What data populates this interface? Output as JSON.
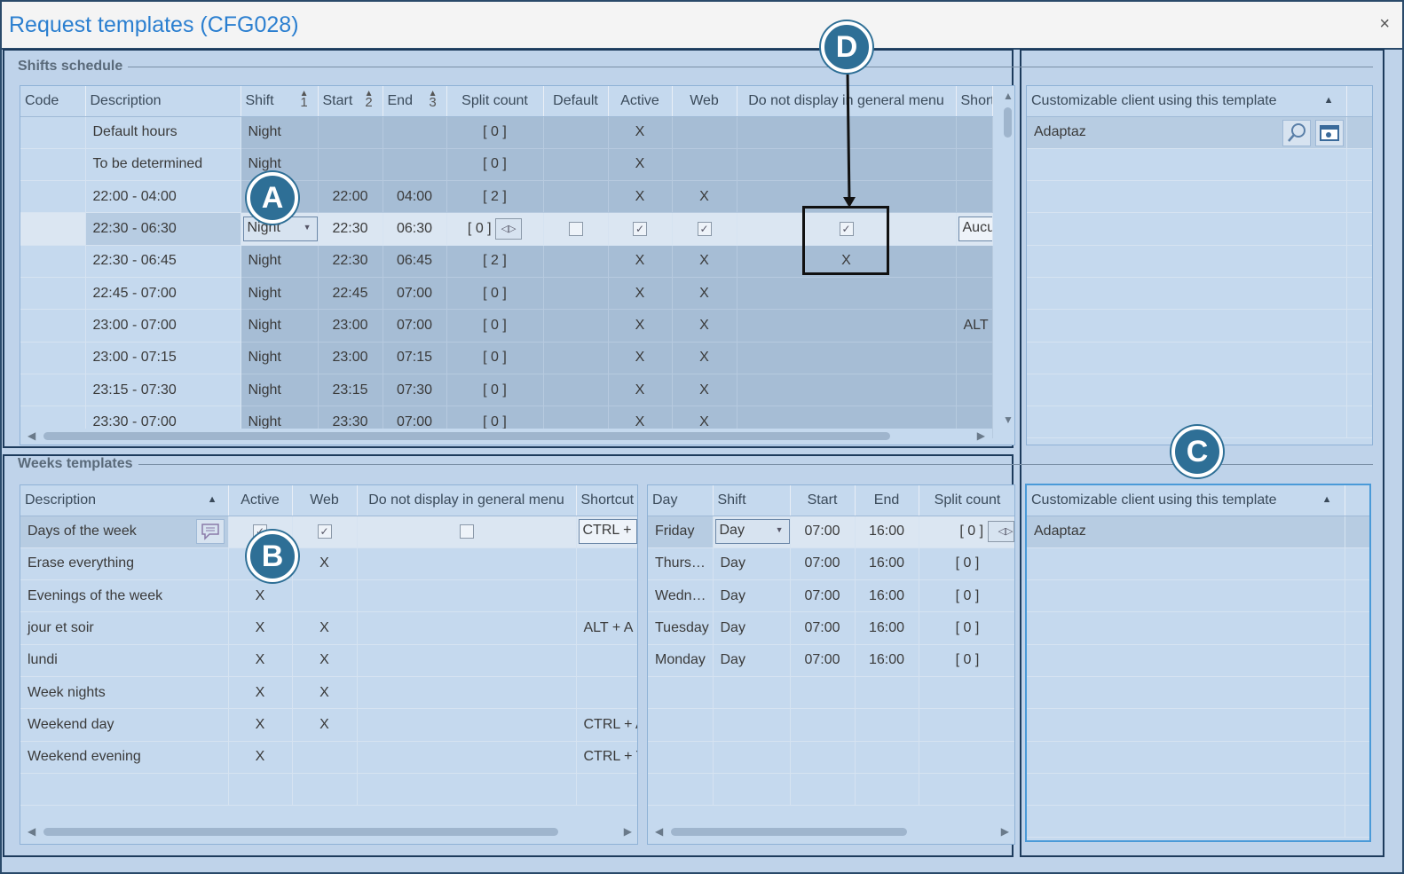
{
  "window": {
    "title": "Request templates (CFG028)",
    "close_glyph": "×"
  },
  "shifts": {
    "group_title": "Shifts schedule",
    "columns": [
      "Code",
      "Description",
      "Shift",
      "Start",
      "End",
      "Split count",
      "Default",
      "Active",
      "Web",
      "Do not display in general menu",
      "Short"
    ],
    "sort_orders": {
      "shift": "1",
      "start": "2",
      "end": "3"
    },
    "rows": [
      {
        "code": "",
        "description": "Default hours",
        "shift": "Night",
        "start": "",
        "end": "",
        "split": "[ 0 ]",
        "default": "",
        "active": "X",
        "web": "",
        "nodisplay": "",
        "short": ""
      },
      {
        "code": "",
        "description": "To be determined",
        "shift": "Night",
        "start": "",
        "end": "",
        "split": "[ 0 ]",
        "default": "",
        "active": "X",
        "web": "",
        "nodisplay": "",
        "short": ""
      },
      {
        "code": "",
        "description": "22:00 - 04:00",
        "shift": "Night",
        "start": "22:00",
        "end": "04:00",
        "split": "[ 2 ]",
        "default": "",
        "active": "X",
        "web": "X",
        "nodisplay": "",
        "short": ""
      },
      {
        "code": "",
        "description": "22:30 - 06:30",
        "shift": "Night",
        "start": "22:30",
        "end": "06:30",
        "split": "[ 0 ]",
        "default": "",
        "active": "✓",
        "web": "✓",
        "nodisplay": "✓",
        "short": "Aucun"
      },
      {
        "code": "",
        "description": "22:30 - 06:45",
        "shift": "Night",
        "start": "22:30",
        "end": "06:45",
        "split": "[ 2 ]",
        "default": "",
        "active": "X",
        "web": "X",
        "nodisplay": "X",
        "short": ""
      },
      {
        "code": "",
        "description": "22:45 - 07:00",
        "shift": "Night",
        "start": "22:45",
        "end": "07:00",
        "split": "[ 0 ]",
        "default": "",
        "active": "X",
        "web": "X",
        "nodisplay": "",
        "short": ""
      },
      {
        "code": "",
        "description": "23:00 - 07:00",
        "shift": "Night",
        "start": "23:00",
        "end": "07:00",
        "split": "[ 0 ]",
        "default": "",
        "active": "X",
        "web": "X",
        "nodisplay": "",
        "short": "ALT -"
      },
      {
        "code": "",
        "description": "23:00 - 07:15",
        "shift": "Night",
        "start": "23:00",
        "end": "07:15",
        "split": "[ 0 ]",
        "default": "",
        "active": "X",
        "web": "X",
        "nodisplay": "",
        "short": ""
      },
      {
        "code": "",
        "description": "23:15 - 07:30",
        "shift": "Night",
        "start": "23:15",
        "end": "07:30",
        "split": "[ 0 ]",
        "default": "",
        "active": "X",
        "web": "X",
        "nodisplay": "",
        "short": ""
      },
      {
        "code": "",
        "description": "23:30 - 07:00",
        "shift": "Night",
        "start": "23:30",
        "end": "07:00",
        "split": "[ 0 ]",
        "default": "",
        "active": "X",
        "web": "X",
        "nodisplay": "",
        "short": ""
      }
    ]
  },
  "client_top": {
    "header": "Customizable client using this template",
    "rows": [
      "Adaptaz"
    ]
  },
  "weeks": {
    "group_title": "Weeks templates",
    "columns": [
      "Description",
      "Active",
      "Web",
      "Do not display in general menu",
      "Shortcut"
    ],
    "rows": [
      {
        "description": "Days of the week",
        "active": "✓",
        "web": "✓",
        "nodisplay": "",
        "shortcut": "CTRL + R"
      },
      {
        "description": "Erase everything",
        "active": "X",
        "web": "X",
        "nodisplay": "",
        "shortcut": ""
      },
      {
        "description": "Evenings of the week",
        "active": "X",
        "web": "",
        "nodisplay": "",
        "shortcut": ""
      },
      {
        "description": "jour et soir",
        "active": "X",
        "web": "X",
        "nodisplay": "",
        "shortcut": "ALT + A"
      },
      {
        "description": "lundi",
        "active": "X",
        "web": "X",
        "nodisplay": "",
        "shortcut": ""
      },
      {
        "description": "Week nights",
        "active": "X",
        "web": "X",
        "nodisplay": "",
        "shortcut": ""
      },
      {
        "description": "Weekend day",
        "active": "X",
        "web": "X",
        "nodisplay": "",
        "shortcut": "CTRL + A"
      },
      {
        "description": "Weekend evening",
        "active": "X",
        "web": "",
        "nodisplay": "",
        "shortcut": "CTRL + T"
      }
    ]
  },
  "days": {
    "columns": [
      "Day",
      "Shift",
      "Start",
      "End",
      "Split count"
    ],
    "rows": [
      {
        "day": "Friday",
        "shift": "Day",
        "start": "07:00",
        "end": "16:00",
        "split": "[ 0 ]"
      },
      {
        "day": "Thurs…",
        "shift": "Day",
        "start": "07:00",
        "end": "16:00",
        "split": "[ 0 ]"
      },
      {
        "day": "Wedn…",
        "shift": "Day",
        "start": "07:00",
        "end": "16:00",
        "split": "[ 0 ]"
      },
      {
        "day": "Tuesday",
        "shift": "Day",
        "start": "07:00",
        "end": "16:00",
        "split": "[ 0 ]"
      },
      {
        "day": "Monday",
        "shift": "Day",
        "start": "07:00",
        "end": "16:00",
        "split": "[ 0 ]"
      }
    ]
  },
  "client_bottom": {
    "header": "Customizable client using this template",
    "rows": [
      "Adaptaz"
    ]
  },
  "callouts": {
    "a": "A",
    "b": "B",
    "c": "C",
    "d": "D"
  },
  "icons": {
    "search": "search-icon",
    "client": "client-window-icon",
    "note": "note-icon"
  }
}
